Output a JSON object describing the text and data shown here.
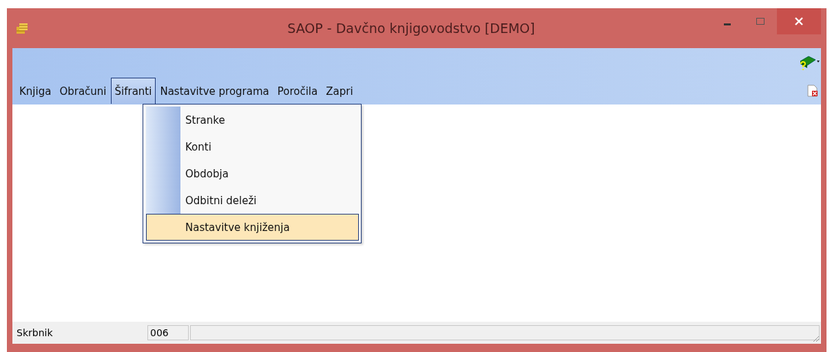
{
  "window": {
    "title": "SAOP -  Davčno knjigovodstvo [DEMO]"
  },
  "menu": [
    {
      "label": "Knjiga",
      "selected": false
    },
    {
      "label": "Obračuni",
      "selected": false
    },
    {
      "label": "Šifranti",
      "selected": true
    },
    {
      "label": "Nastavitve programa",
      "selected": false
    },
    {
      "label": "Poročila",
      "selected": false
    },
    {
      "label": "Zapri",
      "selected": false
    }
  ],
  "dropdown": [
    {
      "label": "Stranke",
      "selected": false
    },
    {
      "label": "Konti",
      "selected": false
    },
    {
      "label": "Obdobja",
      "selected": false
    },
    {
      "label": "Odbitni deleži",
      "selected": false
    },
    {
      "label": "Nastavitve knjiženja",
      "selected": true
    }
  ],
  "status_bar": {
    "user": "Skrbnik",
    "code": "006"
  }
}
